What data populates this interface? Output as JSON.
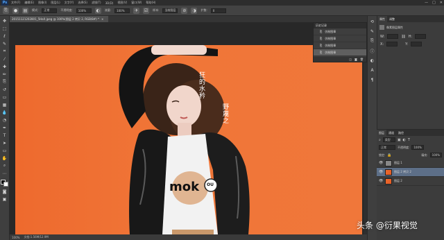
{
  "menubar": {
    "logo": "Ps",
    "items": [
      "文件(F)",
      "编辑(E)",
      "图像(I)",
      "图层(L)",
      "文字(Y)",
      "选择(S)",
      "滤镜(T)",
      "3D(D)",
      "视图(V)",
      "窗口(W)",
      "帮助(H)"
    ],
    "window_controls": [
      "—",
      "□",
      "✕"
    ]
  },
  "options": {
    "mode_label": "模式:",
    "mode_value": "正常",
    "opacity_label": "不透明度:",
    "opacity_value": "100%",
    "flow_label": "流量:",
    "flow_value": "100%",
    "sample_label": "样本:",
    "sample_value": "当前图层",
    "angle_label": "扩散:",
    "angle_value": "0"
  },
  "document": {
    "tab_title": "20151121202801_5HaX.jpeg @ 100%(图层 2 拷贝 2, RGB/8#) *",
    "close": "×"
  },
  "statusbar": {
    "zoom": "100%",
    "doc_size": "文档:1.56M/12.9M"
  },
  "history": {
    "title": "历史记录",
    "items": [
      "仿制图章",
      "仿制图章",
      "仿制图章",
      "仿制图章"
    ],
    "active_index": 3
  },
  "properties": {
    "tabs": [
      "属性",
      "调整"
    ],
    "title": "像素图层属性",
    "w_label": "W:",
    "h_label": "H:",
    "x_label": "X:",
    "y_label": "Y:"
  },
  "layers": {
    "tabs": [
      "图层",
      "通道",
      "路径"
    ],
    "kind_label": "类型",
    "blend_mode": "正常",
    "opacity_label": "不透明度:",
    "opacity_value": "100%",
    "lock_label": "锁定:",
    "fill_label": "填充:",
    "fill_value": "100%",
    "rows": [
      {
        "name": "图层 1",
        "thumb": "gray",
        "active": false
      },
      {
        "name": "图层 2 拷贝 2",
        "thumb": "photo",
        "active": true
      },
      {
        "name": "图层 2",
        "thumb": "photo",
        "active": false
      }
    ]
  },
  "photo": {
    "calligraphy_1": "狂的水矜",
    "calligraphy_2": "野蔑之",
    "tshirt_text": "mok",
    "badge_text": "OU"
  },
  "watermark": "头条 @衍果视觉",
  "colors": {
    "background": "#ef6f33",
    "ui_dark": "#3b3b3b",
    "active_layer": "#5d6f88"
  }
}
